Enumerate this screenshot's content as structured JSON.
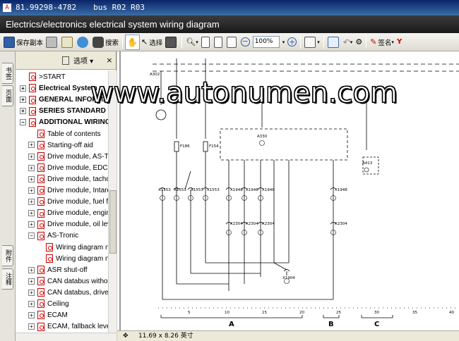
{
  "window": {
    "title_left": "81.99298-4782",
    "title_right": "bus R02 R03"
  },
  "document": {
    "breadcrumb": "Electrics/electronics   electrical system  wiring diagram"
  },
  "toolbar": {
    "save_copy_label": "保存副本",
    "search_label": "搜索",
    "select_label": "选择",
    "zoom_value": "100%",
    "sign_label": "签名"
  },
  "left_tabs": {
    "bookmarks": "书签",
    "pages": "页面",
    "attachments": "附件",
    "comments": "注释"
  },
  "panel": {
    "options_label": "选项",
    "close_glyph": "×",
    "tree": [
      {
        "label": ">START",
        "bold": false,
        "expander": "",
        "level": 0
      },
      {
        "label": "Electrical System",
        "bold": true,
        "expander": "+",
        "level": 0
      },
      {
        "label": "GENERAL INFORMATION",
        "bold": true,
        "expander": "+",
        "level": 0
      },
      {
        "label": "SERIES STANDARD WIRING",
        "bold": true,
        "expander": "+",
        "level": 0
      },
      {
        "label": "ADDITIONAL WIRING",
        "bold": true,
        "expander": "−",
        "level": 0
      },
      {
        "label": "Table of contents",
        "bold": false,
        "expander": "",
        "level": 1
      },
      {
        "label": "Starting-off aid",
        "bold": false,
        "expander": "+",
        "level": 1
      },
      {
        "label": "Drive module, AS-Tronic",
        "bold": false,
        "expander": "+",
        "level": 1
      },
      {
        "label": "Drive module, EDC M",
        "bold": false,
        "expander": "+",
        "level": 1
      },
      {
        "label": "Drive module, tachograph",
        "bold": false,
        "expander": "+",
        "level": 1
      },
      {
        "label": "Drive module, Intarder",
        "bold": false,
        "expander": "+",
        "level": 1
      },
      {
        "label": "Drive module, fuel filter",
        "bold": false,
        "expander": "+",
        "level": 1
      },
      {
        "label": "Drive module, engine",
        "bold": false,
        "expander": "+",
        "level": 1
      },
      {
        "label": "Drive module, oil level",
        "bold": false,
        "expander": "+",
        "level": 1
      },
      {
        "label": "AS-Tronic",
        "bold": false,
        "expander": "−",
        "level": 1
      },
      {
        "label": "Wiring diagram no",
        "bold": false,
        "expander": "",
        "level": 2
      },
      {
        "label": "Wiring diagram no",
        "bold": false,
        "expander": "",
        "level": 2
      },
      {
        "label": "ASR shut-off",
        "bold": false,
        "expander": "+",
        "level": 1
      },
      {
        "label": "CAN databus without",
        "bold": false,
        "expander": "+",
        "level": 1
      },
      {
        "label": "CAN databus, driveline",
        "bold": false,
        "expander": "+",
        "level": 1
      },
      {
        "label": "Ceiling",
        "bold": false,
        "expander": "+",
        "level": 1
      },
      {
        "label": "ECAM",
        "bold": false,
        "expander": "+",
        "level": 1
      },
      {
        "label": "ECAM, fallback level",
        "bold": false,
        "expander": "+",
        "level": 1
      }
    ]
  },
  "diagram": {
    "top_labels": [
      "A302"
    ],
    "fuses": [
      "F186",
      "F154"
    ],
    "modules": [
      "A330",
      "A413"
    ],
    "connectors_left": [
      "X1553",
      "X1553",
      "X1553",
      "X1553"
    ],
    "connectors_mid": [
      "X1948",
      "X1948",
      "X1948"
    ],
    "connector_right": "X1948",
    "connectors_lower": [
      "X2304",
      "X2304",
      "X2304"
    ],
    "connector_lower_right": "X2304",
    "connector_bottom": "X1904",
    "scale_numbers": [
      "5",
      "10",
      "15",
      "20",
      "25",
      "30",
      "35",
      "40"
    ],
    "sections": [
      "A",
      "B",
      "C"
    ]
  },
  "status": {
    "page_size": "11.69 x 8.26 英寸"
  },
  "watermark": "www.autonumen.com"
}
